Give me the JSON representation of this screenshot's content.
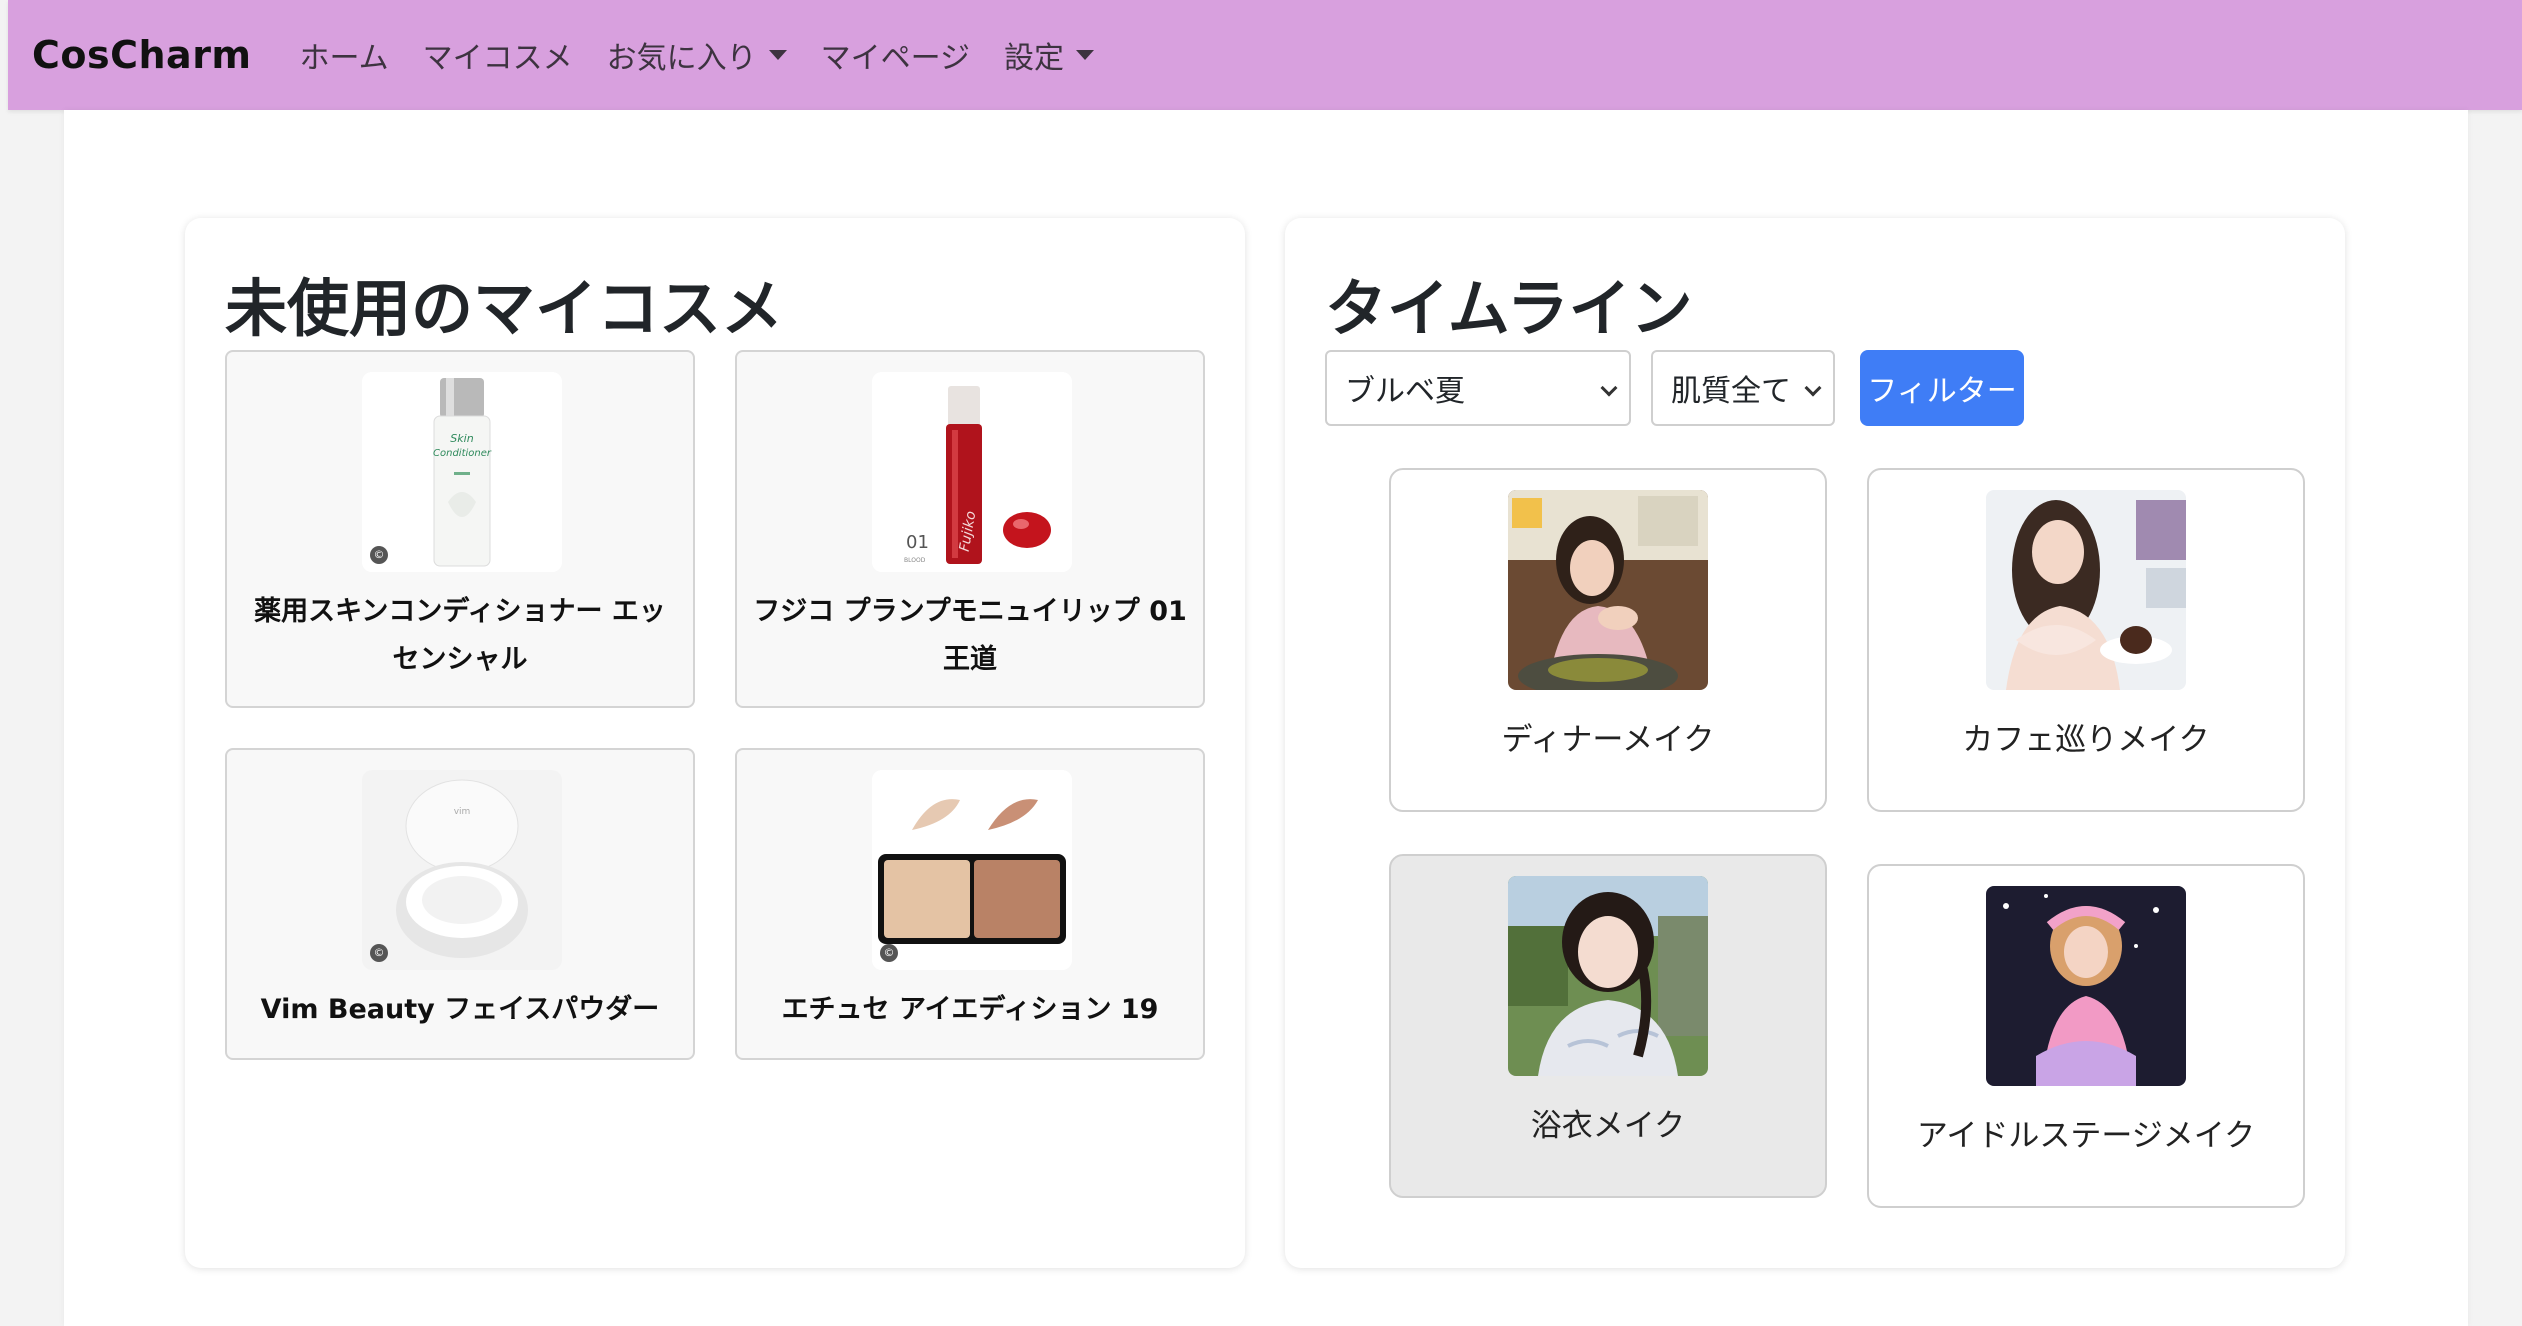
{
  "nav": {
    "brand": "CosCharm",
    "items": [
      {
        "label": "ホーム",
        "dropdown": false
      },
      {
        "label": "マイコスメ",
        "dropdown": false
      },
      {
        "label": "お気に入り",
        "dropdown": true
      },
      {
        "label": "マイページ",
        "dropdown": false
      },
      {
        "label": "設定",
        "dropdown": true
      }
    ]
  },
  "unused": {
    "title": "未使用のマイコスメ",
    "items": [
      {
        "name": "薬用スキンコンディショナー エッセンシャル"
      },
      {
        "name": "フジコ プランプモニュイリップ 01 王道"
      },
      {
        "name": "Vim Beauty フェイスパウダー"
      },
      {
        "name": "エチュセ アイエディション 19"
      }
    ]
  },
  "timeline": {
    "title": "タイムライン",
    "filter_color": "ブルベ夏",
    "filter_skin": "肌質全て",
    "filter_button": "フィルター",
    "posts": [
      {
        "label": "ディナーメイク"
      },
      {
        "label": "カフェ巡りメイク"
      },
      {
        "label": "浴衣メイク"
      },
      {
        "label": "アイドルステージメイク"
      }
    ]
  },
  "colors": {
    "navbar": "#d8a0de",
    "accent": "#3f7df6"
  }
}
